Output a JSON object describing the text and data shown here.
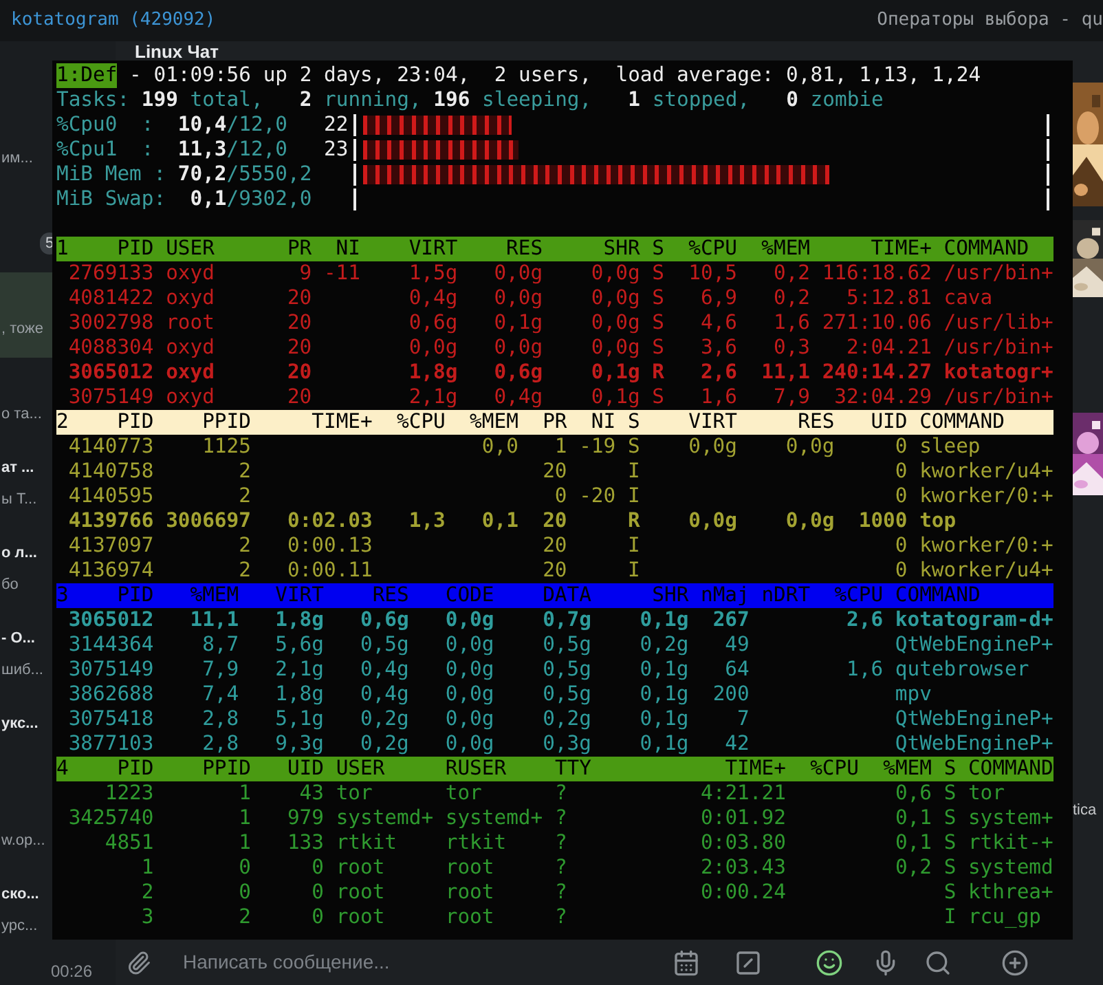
{
  "title_bar": {
    "app_title": "kotatogram (429092)",
    "window_title": "Операторы выбора - qu"
  },
  "chat_list": [
    {
      "preview": "им...",
      "selected": false
    },
    {
      "badge": "5",
      "selected": false
    },
    {
      "preview": ", тоже",
      "selected": true
    },
    {
      "preview": "о та...",
      "selected": false
    },
    {
      "name": "ат ...",
      "preview": "ы Т...",
      "selected": false
    },
    {
      "name": "о л...",
      "preview": "бо",
      "selected": false
    },
    {
      "name": "- О...",
      "preview": "шиб...",
      "selected": false
    },
    {
      "name": "укс...",
      "selected": false
    },
    {
      "preview": "w.op...",
      "selected": false
    },
    {
      "name": "ско...",
      "preview": "урс...",
      "selected": false
    },
    {
      "time": "00:26",
      "selected": false
    }
  ],
  "chat": {
    "title": "Linux Чат",
    "side_text": "tica",
    "composer": {
      "placeholder": "Написать сообщение..."
    }
  },
  "terminal": {
    "window_label": "1:Def",
    "uptime": "- 01:09:56 up 2 days, 23:04,  2 users,  load average: 0,81, 1,13, 1,24",
    "tasks": "Tasks: **199** total,   **2** running, **196** sleeping,   **1** stopped,   **0** zombie",
    "meters": [
      {
        "label": "%Cpu0  :",
        "value": "10,4",
        "total": "/12,0",
        "percent": "22",
        "level": 0.22
      },
      {
        "label": "%Cpu1  :",
        "value": "11,3",
        "total": "/12,0",
        "percent": "23",
        "level": 0.23
      },
      {
        "label": "MiB Mem :",
        "value": "70,2",
        "total": "/5550,2",
        "level": 0.69
      },
      {
        "label": "MiB Swap:",
        "value": "0,1",
        "total": "/9302,0",
        "level": 0
      }
    ],
    "windows": [
      {
        "number": "1",
        "color": "#c41c1c",
        "columns": [
          "PID",
          "USER",
          "PR",
          "NI",
          "VIRT",
          "RES",
          "SHR",
          "S",
          "%CPU",
          "%MEM",
          "TIME+",
          "COMMAND"
        ],
        "rows": [
          {
            "cells": [
              "2769133",
              "oxyd",
              "9",
              "-11",
              "1,5g",
              "0,0g",
              "0,0g",
              "S",
              "10,5",
              "0,2",
              "116:18.62",
              "/usr/bin+"
            ],
            "highlighted": false
          },
          {
            "cells": [
              "4081422",
              "oxyd",
              "20",
              null,
              "0,4g",
              "0,0g",
              "0,0g",
              "S",
              "6,9",
              "0,2",
              "5:12.81",
              "cava"
            ],
            "highlighted": false
          },
          {
            "cells": [
              "3002798",
              "root",
              "20",
              null,
              "0,6g",
              "0,1g",
              "0,0g",
              "S",
              "4,6",
              "1,6",
              "271:10.06",
              "/usr/lib+"
            ],
            "highlighted": false
          },
          {
            "cells": [
              "4088304",
              "oxyd",
              "20",
              null,
              "0,0g",
              "0,0g",
              "0,0g",
              "S",
              "3,6",
              "0,3",
              "2:04.21",
              "/usr/bin+"
            ],
            "highlighted": false
          },
          {
            "cells": [
              "3065012",
              "oxyd",
              "20",
              null,
              "1,8g",
              "0,6g",
              "0,1g",
              "R",
              "2,6",
              "11,1",
              "240:14.27",
              "kotatogr+"
            ],
            "highlighted": true
          },
          {
            "cells": [
              "3075149",
              "oxyd",
              "20",
              null,
              "2,1g",
              "0,4g",
              "0,1g",
              "S",
              "1,6",
              "7,9",
              "32:04.29",
              "/usr/bin+"
            ],
            "highlighted": false
          }
        ]
      },
      {
        "number": "2",
        "color": "#a3a332",
        "columns": [
          "PID",
          "PPID",
          "TIME+",
          "%CPU",
          "%MEM",
          "PR",
          "NI",
          "S",
          "VIRT",
          "RES",
          "UID",
          "COMMAND"
        ],
        "rows": [
          {
            "cells": [
              "4140773",
              "1125",
              null,
              null,
              "0,0",
              "1",
              "-19",
              "S",
              "0,0g",
              "0,0g",
              "0",
              "sleep"
            ],
            "highlighted": false
          },
          {
            "cells": [
              "4140758",
              "2",
              null,
              null,
              null,
              "20",
              null,
              "I",
              null,
              null,
              "0",
              "kworker/u4+"
            ],
            "highlighted": false
          },
          {
            "cells": [
              "4140595",
              "2",
              null,
              null,
              null,
              "0",
              "-20",
              "I",
              null,
              null,
              "0",
              "kworker/0:+"
            ],
            "highlighted": false
          },
          {
            "cells": [
              "4139766",
              "3006697",
              "0:02.03",
              "1,3",
              "0,1",
              "20",
              null,
              "R",
              "0,0g",
              "0,0g",
              "1000",
              "top"
            ],
            "highlighted": true
          },
          {
            "cells": [
              "4137097",
              "2",
              "0:00.13",
              null,
              null,
              "20",
              null,
              "I",
              null,
              null,
              "0",
              "kworker/0:+"
            ],
            "highlighted": false
          },
          {
            "cells": [
              "4136974",
              "2",
              "0:00.11",
              null,
              null,
              "20",
              null,
              "I",
              null,
              null,
              "0",
              "kworker/u4+"
            ],
            "highlighted": false
          }
        ]
      },
      {
        "number": "3",
        "color": "#2f9d9d",
        "columns": [
          "PID",
          "%MEM",
          "VIRT",
          "RES",
          "CODE",
          "DATA",
          "SHR",
          "nMaj",
          "nDRT",
          "%CPU",
          "COMMAND"
        ],
        "rows": [
          {
            "cells": [
              "3065012",
              "11,1",
              "1,8g",
              "0,6g",
              "0,0g",
              "0,7g",
              "0,1g",
              "267",
              null,
              "2,6",
              "kotatogram-d+"
            ],
            "highlighted": true
          },
          {
            "cells": [
              "3144364",
              "8,7",
              "5,6g",
              "0,5g",
              "0,0g",
              "0,5g",
              "0,2g",
              "49",
              null,
              null,
              "QtWebEngineP+"
            ],
            "highlighted": false
          },
          {
            "cells": [
              "3075149",
              "7,9",
              "2,1g",
              "0,4g",
              "0,0g",
              "0,5g",
              "0,1g",
              "64",
              null,
              "1,6",
              "qutebrowser"
            ],
            "highlighted": false
          },
          {
            "cells": [
              "3862688",
              "7,4",
              "1,8g",
              "0,4g",
              "0,0g",
              "0,5g",
              "0,1g",
              "200",
              null,
              null,
              "mpv"
            ],
            "highlighted": false
          },
          {
            "cells": [
              "3075418",
              "2,8",
              "5,1g",
              "0,2g",
              "0,0g",
              "0,2g",
              "0,1g",
              "7",
              null,
              null,
              "QtWebEngineP+"
            ],
            "highlighted": false
          },
          {
            "cells": [
              "3877103",
              "2,8",
              "9,3g",
              "0,2g",
              "0,0g",
              "0,3g",
              "0,1g",
              "42",
              null,
              null,
              "QtWebEngineP+"
            ],
            "highlighted": false
          }
        ]
      },
      {
        "number": "4",
        "color": "#2f9a2f",
        "columns": [
          "PID",
          "PPID",
          "UID",
          "USER",
          "RUSER",
          "TTY",
          "TIME+",
          "%CPU",
          "%MEM",
          "S",
          "COMMAND"
        ],
        "rows": [
          {
            "cells": [
              "1223",
              "1",
              "43",
              "tor",
              "tor",
              "?",
              "4:21.21",
              null,
              "0,6",
              "S",
              "tor"
            ],
            "highlighted": false
          },
          {
            "cells": [
              "3425740",
              "1",
              "979",
              "systemd+",
              "systemd+",
              "?",
              "0:01.92",
              null,
              "0,1",
              "S",
              "system+"
            ],
            "highlighted": false
          },
          {
            "cells": [
              "4851",
              "1",
              "133",
              "rtkit",
              "rtkit",
              "?",
              "0:03.80",
              null,
              "0,1",
              "S",
              "rtkit-+"
            ],
            "highlighted": false
          },
          {
            "cells": [
              "1",
              "0",
              "0",
              "root",
              "root",
              "?",
              "2:03.43",
              null,
              "0,2",
              "S",
              "systemd"
            ],
            "highlighted": false
          },
          {
            "cells": [
              "2",
              "0",
              "0",
              "root",
              "root",
              "?",
              "0:00.24",
              null,
              null,
              "S",
              "kthrea+"
            ],
            "highlighted": false
          },
          {
            "cells": [
              "3",
              "2",
              "0",
              "root",
              "root",
              "?",
              null,
              null,
              null,
              "I",
              "rcu_gp"
            ],
            "highlighted": false
          }
        ]
      }
    ]
  }
}
